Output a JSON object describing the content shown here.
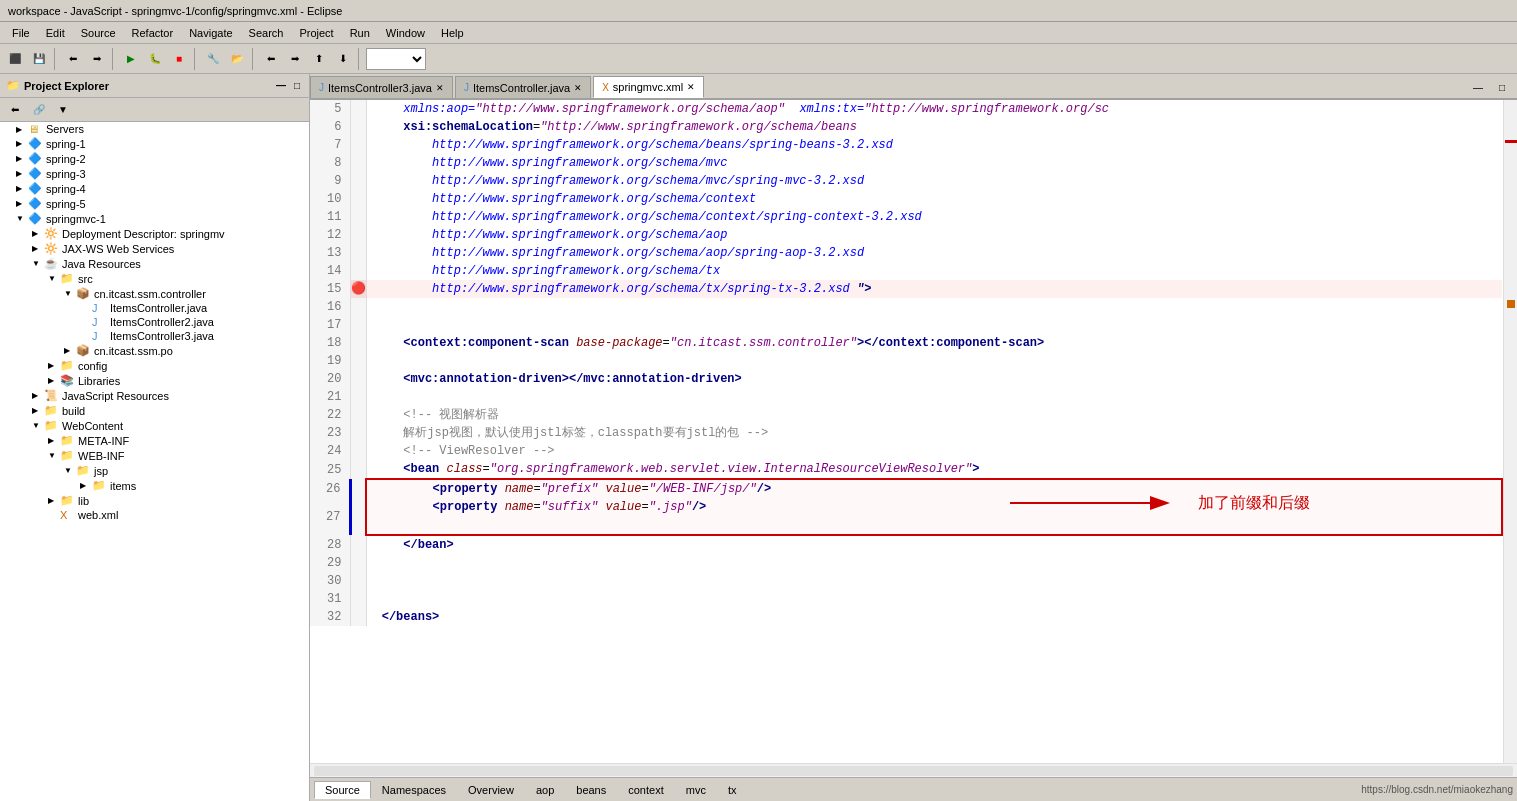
{
  "window": {
    "title": "workspace - JavaScript - springmvc-1/config/springmvc.xml - Eclipse"
  },
  "menu": {
    "items": [
      "File",
      "Edit",
      "Source",
      "Refactor",
      "Navigate",
      "Search",
      "Project",
      "Run",
      "Window",
      "Help"
    ]
  },
  "project_explorer": {
    "title": "Project Explorer",
    "toolbar_icons": [
      "⬅",
      "⬆",
      "⬇"
    ],
    "tree": [
      {
        "label": "Servers",
        "indent": 0,
        "type": "folder",
        "expanded": false
      },
      {
        "label": "spring-1",
        "indent": 0,
        "type": "project",
        "expanded": false
      },
      {
        "label": "spring-2",
        "indent": 0,
        "type": "project",
        "expanded": false
      },
      {
        "label": "spring-3",
        "indent": 0,
        "type": "project",
        "expanded": false
      },
      {
        "label": "spring-4",
        "indent": 0,
        "type": "project",
        "expanded": false
      },
      {
        "label": "spring-5",
        "indent": 0,
        "type": "project",
        "expanded": false
      },
      {
        "label": "springmvc-1",
        "indent": 0,
        "type": "project",
        "expanded": true
      },
      {
        "label": "Deployment Descriptor: springmv",
        "indent": 1,
        "type": "descriptor",
        "expanded": false
      },
      {
        "label": "JAX-WS Web Services",
        "indent": 1,
        "type": "webservice",
        "expanded": false
      },
      {
        "label": "Java Resources",
        "indent": 1,
        "type": "javaresources",
        "expanded": true
      },
      {
        "label": "src",
        "indent": 2,
        "type": "srcfolder",
        "expanded": true
      },
      {
        "label": "cn.itcast.ssm.controller",
        "indent": 3,
        "type": "package",
        "expanded": true
      },
      {
        "label": "ItemsController.java",
        "indent": 4,
        "type": "java"
      },
      {
        "label": "ItemsController2.java",
        "indent": 4,
        "type": "java"
      },
      {
        "label": "ItemsController3.java",
        "indent": 4,
        "type": "java"
      },
      {
        "label": "cn.itcast.ssm.po",
        "indent": 3,
        "type": "package",
        "expanded": false
      },
      {
        "label": "config",
        "indent": 2,
        "type": "folder",
        "expanded": false
      },
      {
        "label": "Libraries",
        "indent": 2,
        "type": "libraries",
        "expanded": false
      },
      {
        "label": "JavaScript Resources",
        "indent": 1,
        "type": "jsresources",
        "expanded": false
      },
      {
        "label": "build",
        "indent": 1,
        "type": "folder",
        "expanded": false
      },
      {
        "label": "WebContent",
        "indent": 1,
        "type": "folder",
        "expanded": true
      },
      {
        "label": "META-INF",
        "indent": 2,
        "type": "folder",
        "expanded": false
      },
      {
        "label": "WEB-INF",
        "indent": 2,
        "type": "folder",
        "expanded": true
      },
      {
        "label": "jsp",
        "indent": 3,
        "type": "folder",
        "expanded": true
      },
      {
        "label": "items",
        "indent": 4,
        "type": "folder",
        "expanded": false
      },
      {
        "label": "lib",
        "indent": 2,
        "type": "folder",
        "expanded": false
      },
      {
        "label": "web.xml",
        "indent": 2,
        "type": "xml"
      }
    ]
  },
  "tabs": [
    {
      "label": "ItemsController3.java",
      "active": false,
      "icon": "J"
    },
    {
      "label": "ItemsController.java",
      "active": false,
      "icon": "J"
    },
    {
      "label": "springmvc.xml",
      "active": true,
      "icon": "X"
    }
  ],
  "code": {
    "lines": [
      {
        "num": 5,
        "marker": "",
        "content": "    xmlns:aop=\"http://www.springframework.org/schema/aop\"  xmlns:tx=\"http://www.springframework.org/sc",
        "highlight": false
      },
      {
        "num": 6,
        "marker": "",
        "content": "    xsi:schemaLocation=\"http://www.springframework.org/schema/beans",
        "highlight": false
      },
      {
        "num": 7,
        "marker": "",
        "content": "        http://www.springframework.org/schema/beans/spring-beans-3.2.xsd",
        "highlight": false
      },
      {
        "num": 8,
        "marker": "",
        "content": "        http://www.springframework.org/schema/mvc",
        "highlight": false
      },
      {
        "num": 9,
        "marker": "",
        "content": "        http://www.springframework.org/schema/mvc/spring-mvc-3.2.xsd",
        "highlight": false
      },
      {
        "num": 10,
        "marker": "",
        "content": "        http://www.springframework.org/schema/context",
        "highlight": false
      },
      {
        "num": 11,
        "marker": "",
        "content": "        http://www.springframework.org/schema/context/spring-context-3.2.xsd",
        "highlight": false
      },
      {
        "num": 12,
        "marker": "",
        "content": "        http://www.springframework.org/schema/aop",
        "highlight": false
      },
      {
        "num": 13,
        "marker": "",
        "content": "        http://www.springframework.org/schema/aop/spring-aop-3.2.xsd",
        "highlight": false
      },
      {
        "num": 14,
        "marker": "",
        "content": "        http://www.springframework.org/schema/tx",
        "highlight": false
      },
      {
        "num": 15,
        "marker": "🔴",
        "content": "        http://www.springframework.org/schema/tx/spring-tx-3.2.xsd \">",
        "highlight": false
      },
      {
        "num": 16,
        "marker": "",
        "content": "",
        "highlight": false
      },
      {
        "num": 17,
        "marker": "",
        "content": "",
        "highlight": false
      },
      {
        "num": 18,
        "marker": "",
        "content": "    <context:component-scan base-package=\"cn.itcast.ssm.controller\"></context:component-scan>",
        "highlight": false
      },
      {
        "num": 19,
        "marker": "",
        "content": "",
        "highlight": false
      },
      {
        "num": 20,
        "marker": "",
        "content": "    <mvc:annotation-driven></mvc:annotation-driven>",
        "highlight": false
      },
      {
        "num": 21,
        "marker": "",
        "content": "",
        "highlight": false
      },
      {
        "num": 22,
        "marker": "",
        "content": "    <!-- 视图解析器",
        "highlight": false
      },
      {
        "num": 23,
        "marker": "",
        "content": "    解析jsp视图，默认使用jstl标签，classpath要有jstl的包 -->",
        "highlight": false
      },
      {
        "num": 24,
        "marker": "",
        "content": "    <!-- ViewResolver -->",
        "highlight": false
      },
      {
        "num": 25,
        "marker": "",
        "content": "    <bean class=\"org.springframework.web.servlet.view.InternalResourceViewResolver\">",
        "highlight": false
      },
      {
        "num": 26,
        "marker": "",
        "content": "        <property name=\"prefix\" value=\"/WEB-INF/jsp/\"/>",
        "highlight": true,
        "boxed": true
      },
      {
        "num": 27,
        "marker": "",
        "content": "        <property name=\"suffix\" value=\".jsp\"/>",
        "highlight": true,
        "boxed": true
      },
      {
        "num": 28,
        "marker": "",
        "content": "    </bean>",
        "highlight": false
      },
      {
        "num": 29,
        "marker": "",
        "content": "",
        "highlight": false
      },
      {
        "num": 30,
        "marker": "",
        "content": "",
        "highlight": false
      },
      {
        "num": 31,
        "marker": "",
        "content": "",
        "highlight": false
      },
      {
        "num": 32,
        "marker": "",
        "content": " </beans>",
        "highlight": false
      }
    ]
  },
  "bottom_tabs": [
    "Source",
    "Namespaces",
    "Overview",
    "aop",
    "beans",
    "context",
    "mvc",
    "tx"
  ],
  "active_bottom_tab": "Source",
  "status_bar": {
    "left": "",
    "right": "https://blog.csdn.net/miaokezhang"
  },
  "annotation": {
    "text": "加了前缀和后缀"
  }
}
